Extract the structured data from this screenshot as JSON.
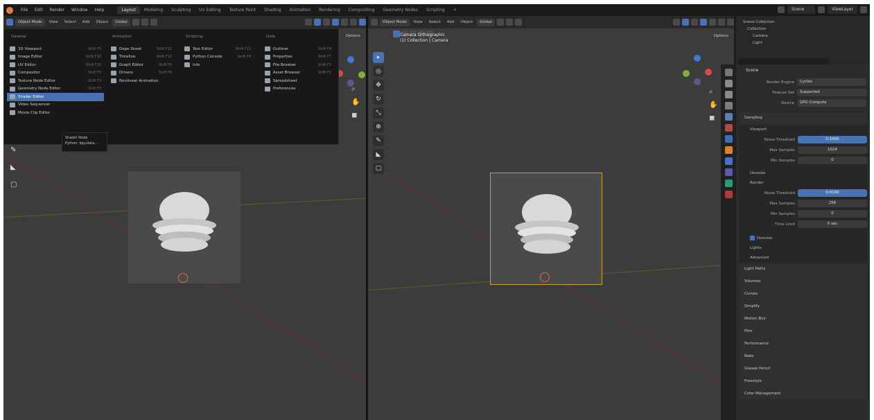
{
  "menubar": {
    "items": [
      "File",
      "Edit",
      "Render",
      "Window",
      "Help"
    ],
    "tabs": [
      "Layout",
      "Modeling",
      "Sculpting",
      "UV Editing",
      "Texture Paint",
      "Shading",
      "Animation",
      "Rendering",
      "Compositing",
      "Geometry Nodes",
      "Scripting",
      "+"
    ],
    "active_tab": "Layout",
    "scene_label": "Scene",
    "view_layer_label": "ViewLayer"
  },
  "viewport_left": {
    "header": {
      "mode": "Object Mode",
      "menus": [
        "View",
        "Select",
        "Add",
        "Object"
      ],
      "transform": "Global",
      "options": "Options"
    },
    "editor_menu": {
      "columns": [
        {
          "title": "General",
          "items": [
            {
              "label": "3D Viewport",
              "shortcut": "Shift F5"
            },
            {
              "label": "Image Editor",
              "shortcut": "Shift F10"
            },
            {
              "label": "UV Editor",
              "shortcut": "Shift F10"
            },
            {
              "label": "Compositor",
              "shortcut": "Shift F3"
            },
            {
              "label": "Texture Node Editor",
              "shortcut": "Shift F3"
            },
            {
              "label": "Geometry Node Editor",
              "shortcut": "Shift F3"
            },
            {
              "label": "Shader Editor",
              "shortcut": "Shift F3"
            },
            {
              "label": "Video Sequencer",
              "shortcut": "Shift F8"
            },
            {
              "label": "Movie Clip Editor",
              "shortcut": "Shift F2"
            }
          ]
        },
        {
          "title": "Animation",
          "items": [
            {
              "label": "Dope Sheet",
              "shortcut": "Shift F12"
            },
            {
              "label": "Timeline",
              "shortcut": "Shift F12"
            },
            {
              "label": "Graph Editor",
              "shortcut": "Shift F6"
            },
            {
              "label": "Drivers",
              "shortcut": "Shift F6"
            },
            {
              "label": "Nonlinear Animation",
              "shortcut": ""
            }
          ]
        },
        {
          "title": "Scripting",
          "items": [
            {
              "label": "Text Editor",
              "shortcut": "Shift F11"
            },
            {
              "label": "Python Console",
              "shortcut": "Shift F4"
            },
            {
              "label": "Info",
              "shortcut": ""
            }
          ]
        },
        {
          "title": "Data",
          "items": [
            {
              "label": "Outliner",
              "shortcut": "Shift F9"
            },
            {
              "label": "Properties",
              "shortcut": "Shift F7"
            },
            {
              "label": "File Browser",
              "shortcut": "Shift F1"
            },
            {
              "label": "Asset Browser",
              "shortcut": "Shift F1"
            },
            {
              "label": "Spreadsheet",
              "shortcut": ""
            },
            {
              "label": "Preferences",
              "shortcut": ""
            }
          ]
        }
      ],
      "highlighted": "Shader Editor",
      "tooltip_line1": "Shader Node",
      "tooltip_line2": "Python: bpy.data..."
    }
  },
  "viewport_right": {
    "header": {
      "mode": "Object Mode",
      "menus": [
        "View",
        "Select",
        "Add",
        "Object"
      ],
      "transform": "Global",
      "options": "Options"
    },
    "camera_label_1": "Camera Orthographic",
    "camera_label_2": "(1) Collection | Camera"
  },
  "outliner": {
    "title": "Scene Collection",
    "rows": [
      "Collection",
      "Camera",
      "Light"
    ]
  },
  "properties": {
    "header": "Scene",
    "fields": [
      {
        "label": "Render Engine",
        "value": "Cycles"
      },
      {
        "label": "Feature Set",
        "value": "Supported"
      },
      {
        "label": "Device",
        "value": "GPU Compute"
      }
    ],
    "sampling": "Sampling",
    "viewport": {
      "title": "Viewport",
      "noise_threshold_label": "Noise Threshold",
      "noise_threshold": "0.1000",
      "max_samples_label": "Max Samples",
      "max_samples": "1024",
      "min_samples_label": "Min Samples",
      "min_samples": "0"
    },
    "denoise": "Denoise",
    "render": {
      "title": "Render",
      "noise_threshold_label": "Noise Threshold",
      "noise_threshold": "0.0100",
      "max_samples_label": "Max Samples",
      "max_samples": "256",
      "min_samples_label": "Min Samples",
      "min_samples": "0",
      "time_limit_label": "Time Limit",
      "time_limit": "0 sec"
    },
    "subsections": [
      "Denoise",
      "Lights",
      "Advanced"
    ],
    "sections": [
      "Light Paths",
      "Volumes",
      "Curves",
      "Simplify",
      "Motion Blur",
      "Film",
      "Performance",
      "Bake",
      "Grease Pencil",
      "Freestyle",
      "Color Management"
    ]
  },
  "colors": {
    "accent": "#4772b3",
    "camera_selected": "#c9a227",
    "x_axis": "#d84a4a",
    "y_axis": "#7fb03a",
    "z_axis": "#3e79d6"
  }
}
